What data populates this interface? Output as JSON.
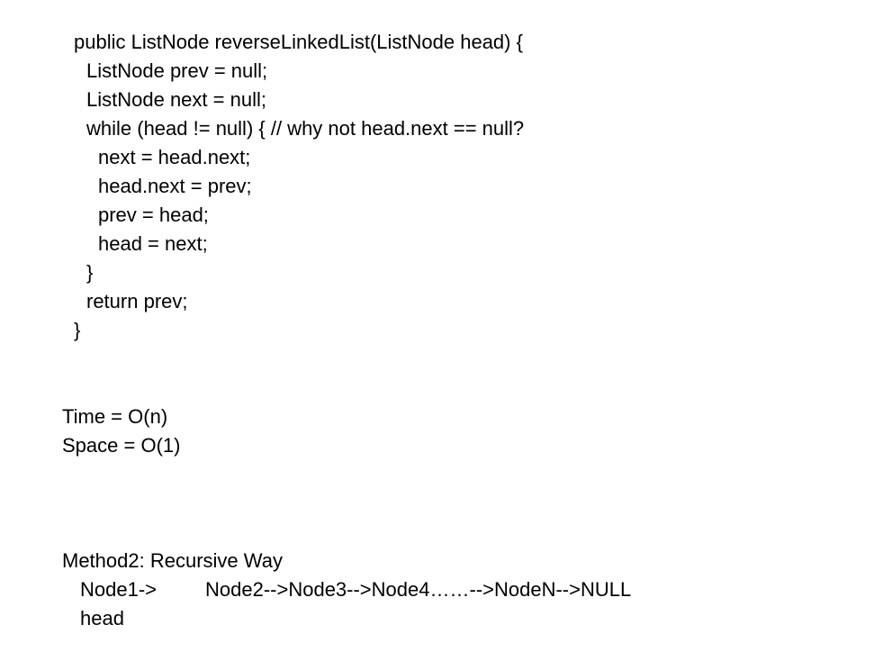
{
  "code_lines": [
    "public ListNode reverseLinkedList(ListNode head) {",
    "ListNode prev = null;",
    "ListNode next = null;",
    "while (head != null) { // why not head.next == null?",
    "next = head.next;",
    "head.next = prev;",
    "prev = head;",
    "head = next;",
    "}",
    "return prev;",
    "}"
  ],
  "complexity": {
    "time": "Time = O(n)",
    "space": "Space = O(1)"
  },
  "method2": {
    "heading": "Method2: Recursive Way",
    "node1": "Node1->",
    "chain": "Node2-->Node3-->Node4……-->NodeN-->NULL",
    "head_label": "head"
  }
}
